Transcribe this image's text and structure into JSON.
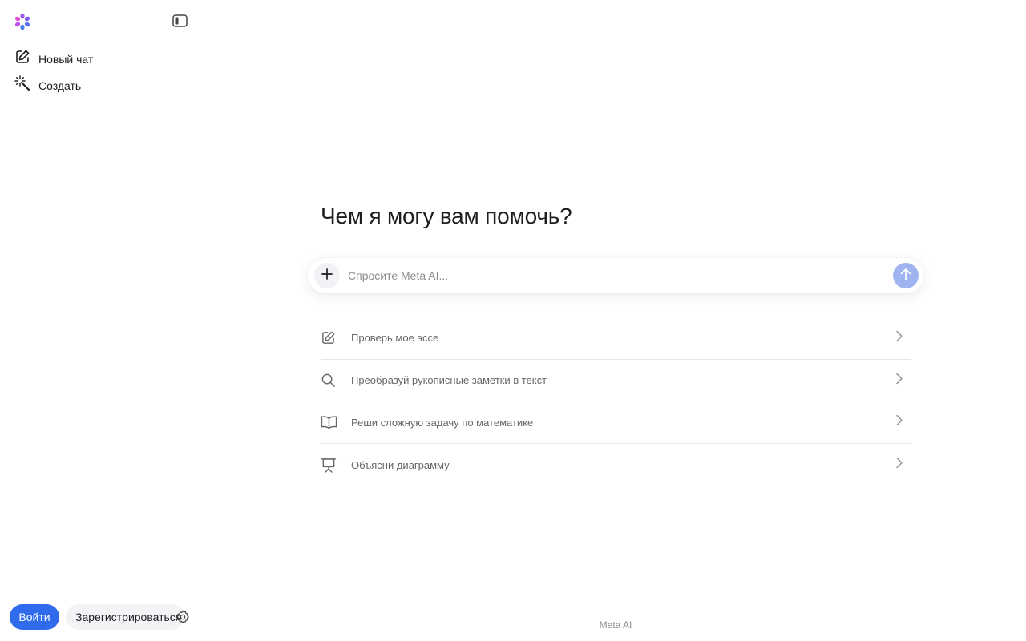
{
  "sidebar": {
    "logo": "meta-ai-logo",
    "collapse_icon": "sidebar-toggle-icon",
    "items": [
      {
        "label": "Новый чат",
        "icon": "edit-icon"
      },
      {
        "label": "Создать",
        "icon": "magic-wand-icon"
      }
    ],
    "login_label": "Войти",
    "signup_label": "Зарегистрироваться",
    "settings_icon": "gear-icon"
  },
  "main": {
    "title": "Чем я могу вам помочь?",
    "composer": {
      "placeholder": "Спросите Meta AI...",
      "plus_icon": "plus-icon",
      "send_icon": "arrow-up-icon"
    },
    "suggestions": [
      {
        "label": "Проверь мое эссе",
        "icon": "edit-icon"
      },
      {
        "label": "Преобразуй рукописные заметки в текст",
        "icon": "search-icon"
      },
      {
        "label": "Реши сложную задачу по математике",
        "icon": "book-icon"
      },
      {
        "label": "Объясни диаграмму",
        "icon": "presentation-icon"
      }
    ]
  },
  "footer": {
    "text": "Meta AI"
  },
  "colors": {
    "accent": "#2f6bec",
    "send_button": "#9fb4f0",
    "muted_text": "#65676b"
  }
}
